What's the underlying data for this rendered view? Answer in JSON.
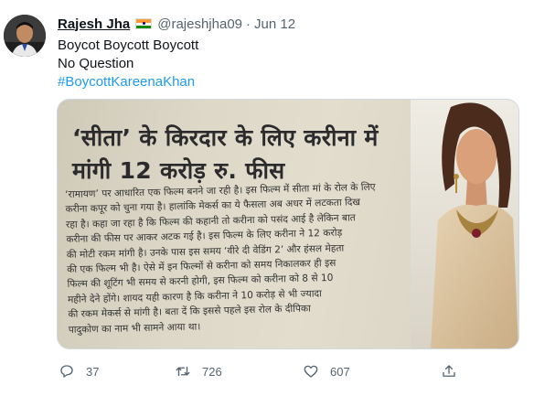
{
  "tweet": {
    "author_name": "Rajesh Jha",
    "handle": "@rajeshjha09",
    "separator": "·",
    "date": "Jun 12",
    "lines": [
      "Boycot Boycott Boycott",
      "No Question"
    ],
    "hashtag": "#BoycottKareenaKhan"
  },
  "media": {
    "headline": [
      "‘सीता’ के किरदार के लिए करीना में",
      "मांगी 12 करोड़ रु. फीस"
    ],
    "body": [
      "‘रामायण’ पर आधारित एक फिल्म बनने जा रही है। इस फिल्म में सीता मां के रोल के लिए",
      "करीना कपूर को चुना गया है। हालांकि मेकर्स का ये फैसला अब अधर में लटकता दिख",
      "रहा है। कहा जा रहा है कि फिल्म की कहानी तो करीना को पसंद आई है लेकिन बात",
      "करीना की फीस पर आकर अटक गई है। इस फिल्म के लिए करीना ने 12 करोड़",
      "की मोटी रकम मांगी है। उनके पास इस समय ‘वीरे दी वेडिंग 2’ और हंसल मेहता",
      "की एक फिल्म भी है। ऐसे में इन फिल्मों से करीना को समय निकालकर ही इस",
      "फिल्म की शूटिंग भी समय से करनी होगी, इस फिल्म को करीना को 8 से 10",
      "महीने देने होंगे। शायद यही कारण है कि करीना ने 10 करोड़ से भी ज्यादा",
      "की रकम मेकर्स से मांगी है। बता दें कि इससे पहले इस रोल के दीपिका",
      "पादुकोण का नाम भी सामने आया था।"
    ]
  },
  "actions": {
    "reply_count": "37",
    "retweet_count": "726",
    "like_count": "607"
  },
  "icons": {
    "reply": "comment-icon",
    "retweet": "retweet-icon",
    "like": "heart-icon",
    "share": "share-icon",
    "flag": "india-flag-icon"
  },
  "colors": {
    "link": "#1d9bf0",
    "secondary_text": "#536471",
    "primary_text": "#0f1419"
  }
}
